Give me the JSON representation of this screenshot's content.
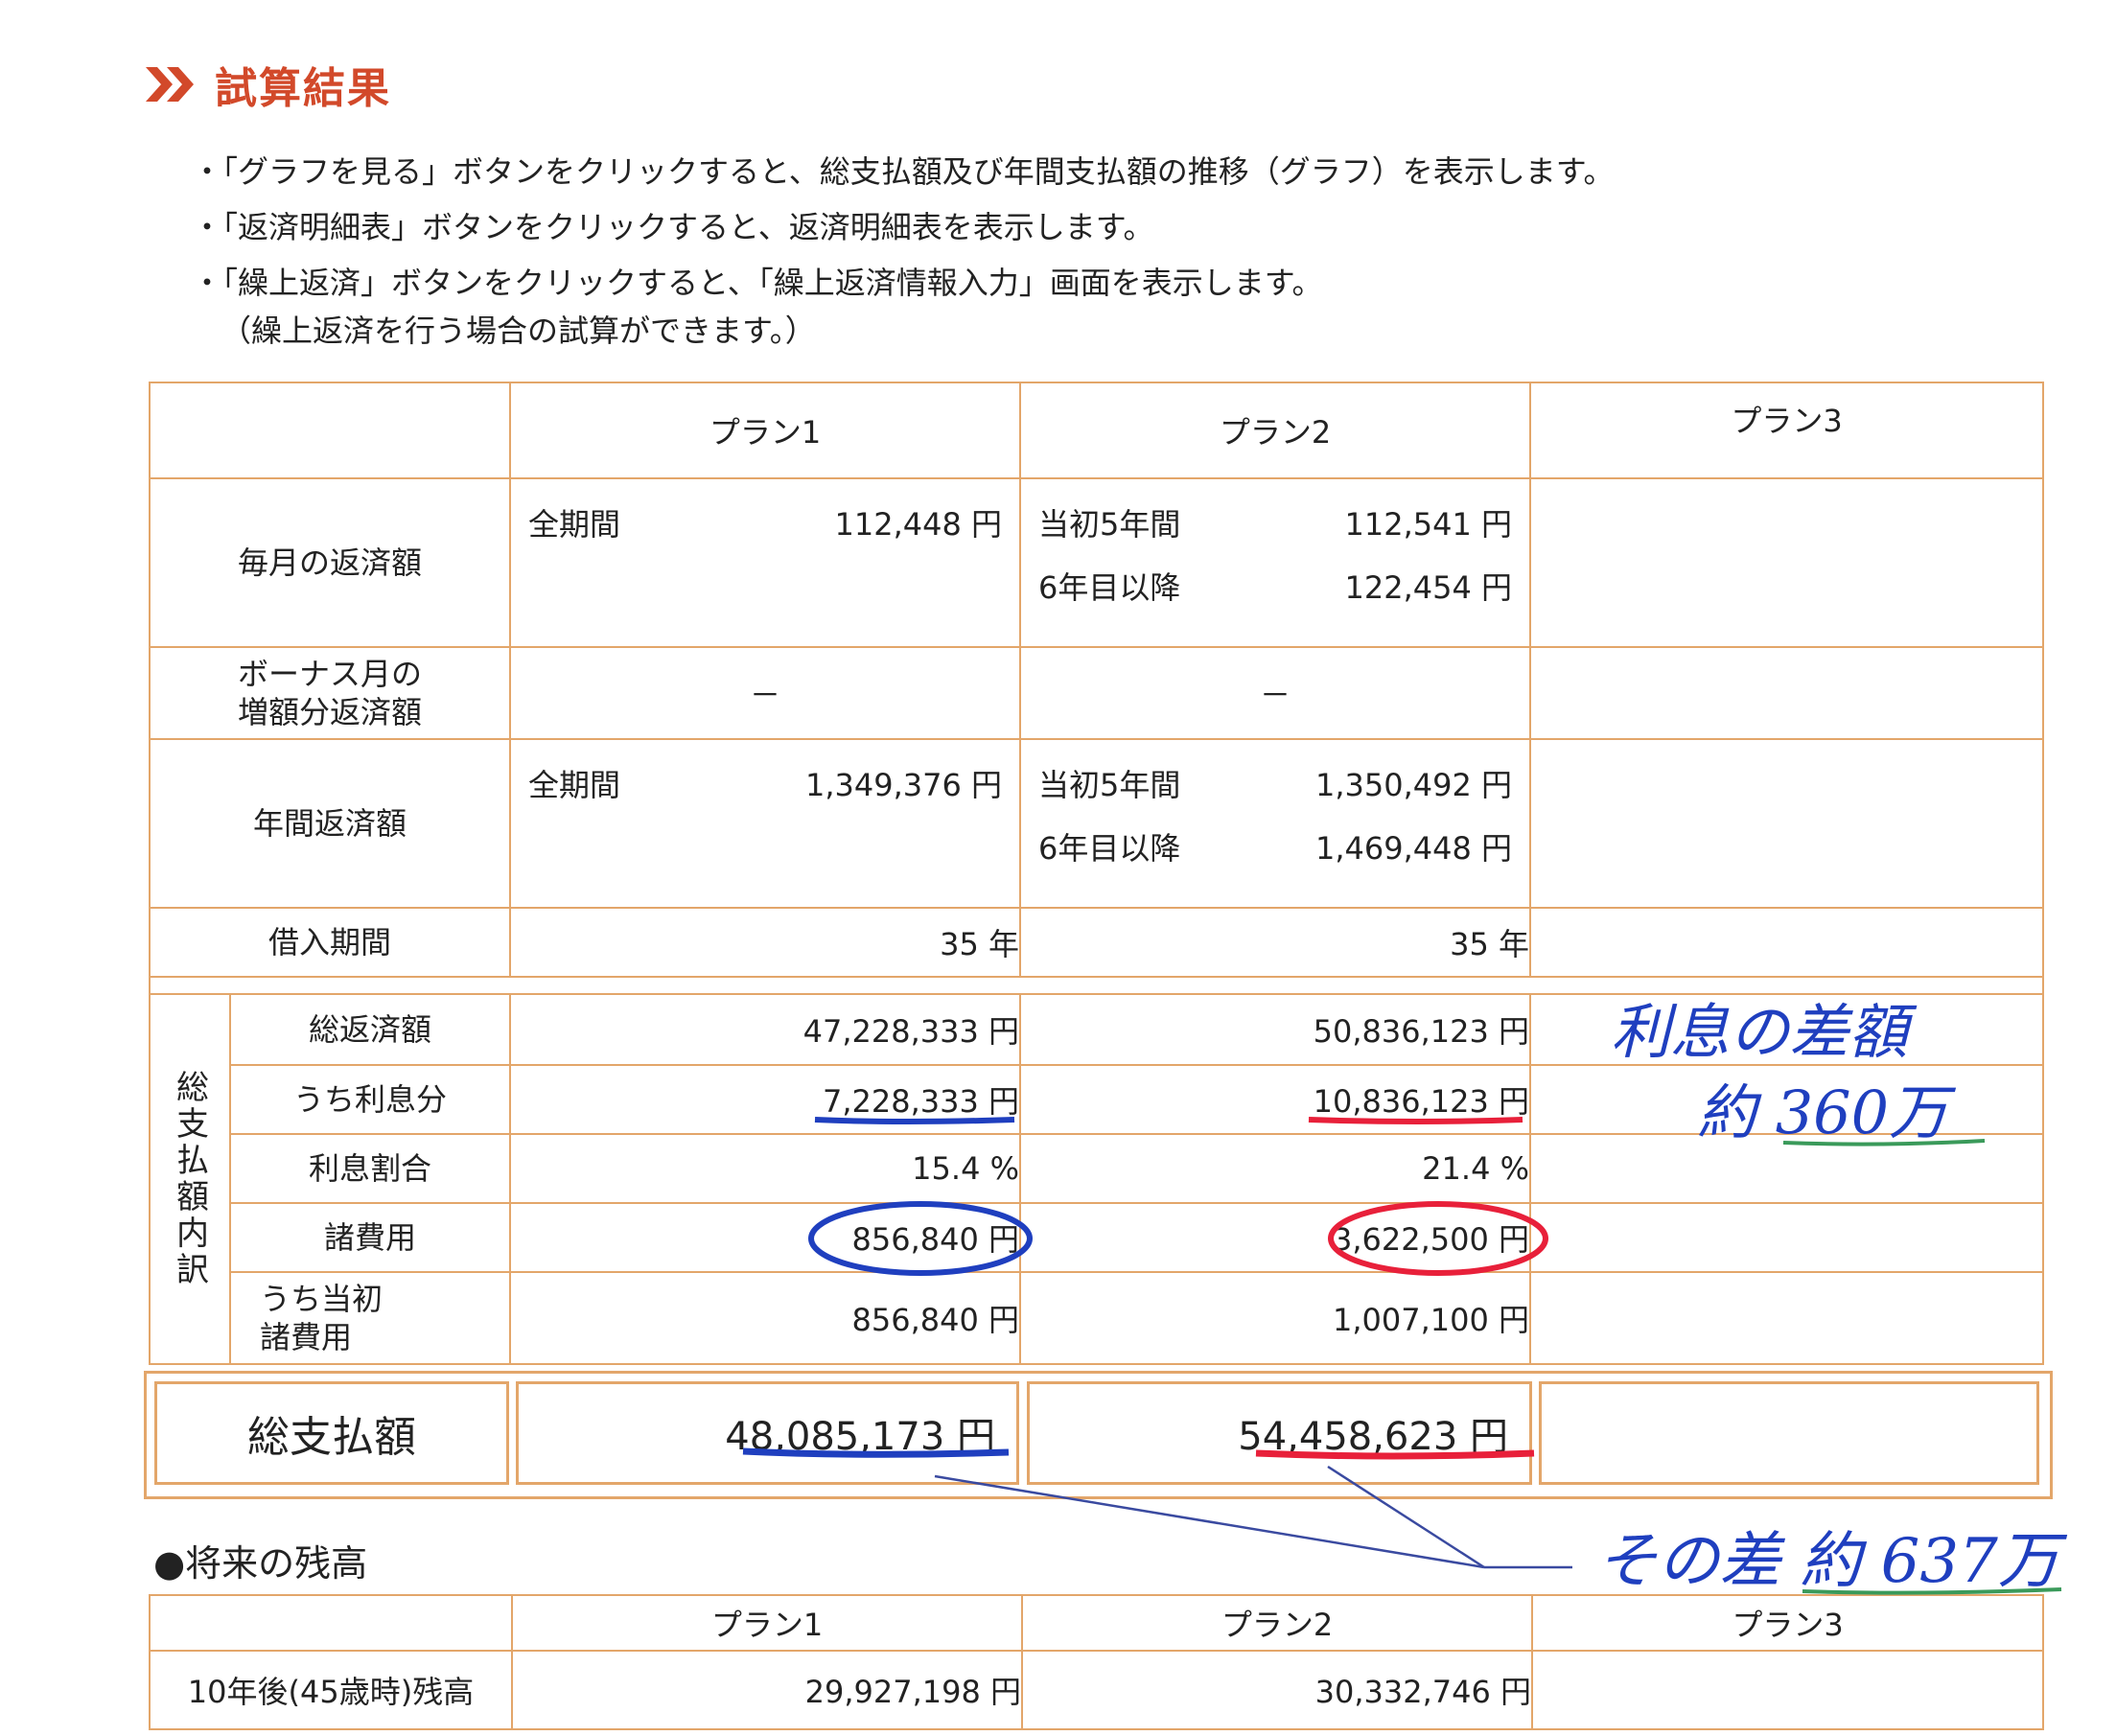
{
  "title": "試算結果",
  "bullets": [
    "・「グラフを見る」ボタンをクリックすると、総支払額及び年間支払額の推移（グラフ）を表示します。",
    "・「返済明細表」ボタンをクリックすると、返済明細表を表示します。",
    "・「繰上返済」ボタンをクリックすると、「繰上返済情報入力」画面を表示します。",
    "（繰上返済を行う場合の試算ができます。）"
  ],
  "plans": [
    "プラン1",
    "プラン2",
    "プラン3"
  ],
  "monthly": {
    "label": "毎月の返済額",
    "p1": {
      "term": "全期間",
      "amount": "112,448 円"
    },
    "p2": [
      {
        "term": "当初5年間",
        "amount": "112,541 円"
      },
      {
        "term": "6年目以降",
        "amount": "122,454 円"
      }
    ]
  },
  "bonus": {
    "label1": "ボーナス月の",
    "label2": "増額分返済額",
    "p1": "－",
    "p2": "－"
  },
  "annual": {
    "label": "年間返済額",
    "p1": {
      "term": "全期間",
      "amount": "1,349,376 円"
    },
    "p2": [
      {
        "term": "当初5年間",
        "amount": "1,350,492 円"
      },
      {
        "term": "6年目以降",
        "amount": "1,469,448 円"
      }
    ]
  },
  "period": {
    "label": "借入期間",
    "p1": "35 年",
    "p2": "35 年"
  },
  "breakdown": {
    "group_label": "総支払額内訳",
    "rows": [
      {
        "label": "総返済額",
        "p1": "47,228,333 円",
        "p2": "50,836,123 円"
      },
      {
        "label": "うち利息分",
        "p1": "7,228,333 円",
        "p2": "10,836,123 円"
      },
      {
        "label": "利息割合",
        "p1": "15.4 %",
        "p2": "21.4 %"
      },
      {
        "label": "諸費用",
        "p1": "856,840 円",
        "p2": "3,622,500 円"
      },
      {
        "label1": "うち当初",
        "label2": "諸費用",
        "p1": "856,840 円",
        "p2": "1,007,100 円"
      }
    ]
  },
  "total": {
    "label": "総支払額",
    "p1": "48,085,173 円",
    "p2": "54,458,623 円"
  },
  "future": {
    "title": "●将来の残高",
    "row_label": "10年後(45歳時)残高",
    "p1": "29,927,198 円",
    "p2": "30,332,746 円"
  },
  "annotations": {
    "interest_diff_1": "利息の差額",
    "interest_diff_2": "約 360万",
    "total_diff": "その差 約 637万",
    "colors": {
      "blue": "#1f3fbf",
      "red": "#e8203a",
      "green": "#3a9a5a"
    }
  }
}
